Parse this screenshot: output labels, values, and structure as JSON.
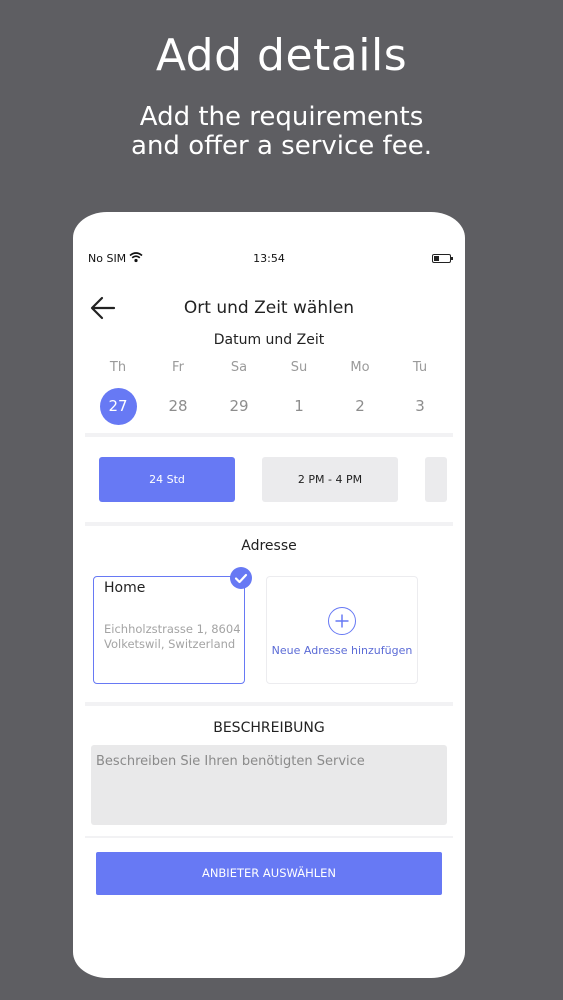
{
  "hero": {
    "title": "Add details",
    "subtitle_line1": "Add the requirements",
    "subtitle_line2": "and offer a service fee."
  },
  "status_bar": {
    "carrier": "No SIM",
    "time": "13:54"
  },
  "header": {
    "title": "Ort und Zeit wählen"
  },
  "date_section": {
    "label": "Datum und Zeit",
    "days": [
      {
        "name": "Th",
        "date": "27"
      },
      {
        "name": "Fr",
        "date": "28"
      },
      {
        "name": "Sa",
        "date": "29"
      },
      {
        "name": "Su",
        "date": "1"
      },
      {
        "name": "Mo",
        "date": "2"
      },
      {
        "name": "Tu",
        "date": "3"
      }
    ]
  },
  "time_slots": [
    {
      "label": "24 Std"
    },
    {
      "label": "2 PM - 4 PM"
    }
  ],
  "address_section": {
    "label": "Adresse",
    "home": {
      "name": "Home",
      "line1": "Eichholzstrasse 1, 8604",
      "line2": "Volketswil, Switzerland"
    },
    "add_new_label": "Neue Adresse hinzufügen"
  },
  "description_section": {
    "label": "BESCHREIBUNG",
    "placeholder": "Beschreiben Sie Ihren benötigten Service"
  },
  "cta_label": "ANBIETER AUSWÄHLEN",
  "colors": {
    "accent": "#6779f4",
    "background": "#5e5e62",
    "slot_inactive": "#ebebed",
    "textarea_bg": "#e9e9ea"
  }
}
